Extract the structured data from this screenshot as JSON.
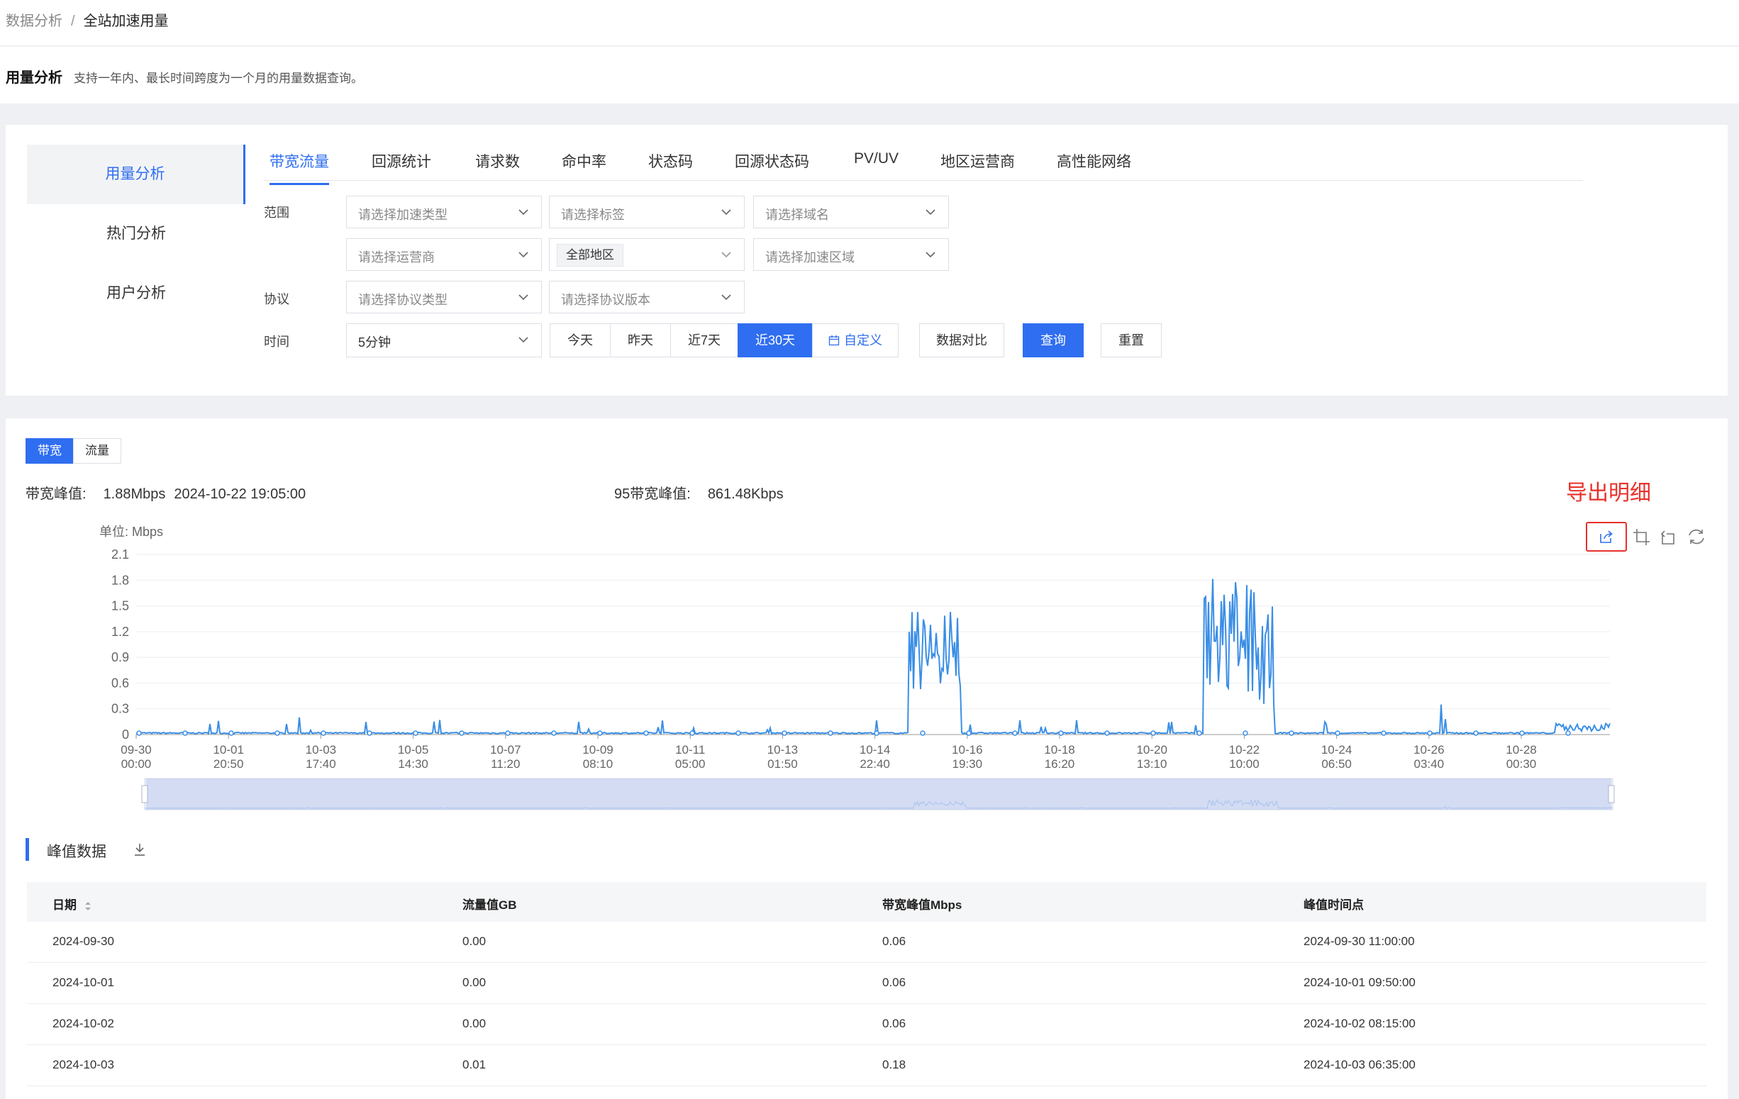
{
  "breadcrumb": {
    "parent": "数据分析",
    "separator": "/",
    "current": "全站加速用量"
  },
  "header": {
    "title": "用量分析",
    "description": "支持一年内、最长时间跨度为一个月的用量数据查询。"
  },
  "sidebar": {
    "items": [
      {
        "label": "用量分析",
        "active": true
      },
      {
        "label": "热门分析",
        "active": false
      },
      {
        "label": "用户分析",
        "active": false
      }
    ]
  },
  "tabs": [
    {
      "label": "带宽流量",
      "active": true
    },
    {
      "label": "回源统计"
    },
    {
      "label": "请求数"
    },
    {
      "label": "命中率"
    },
    {
      "label": "状态码"
    },
    {
      "label": "回源状态码"
    },
    {
      "label": "PV/UV"
    },
    {
      "label": "地区运营商"
    },
    {
      "label": "高性能网络"
    }
  ],
  "filters": {
    "range_label": "范围",
    "protocol_label": "协议",
    "time_label": "时间",
    "accel_type_placeholder": "请选择加速类型",
    "tag_placeholder": "请选择标签",
    "domain_placeholder": "请选择域名",
    "isp_placeholder": "请选择运营商",
    "region_value": "全部地区",
    "accel_region_placeholder": "请选择加速区域",
    "protocol_type_placeholder": "请选择协议类型",
    "protocol_version_placeholder": "请选择协议版本",
    "granularity_value": "5分钟",
    "quick_ranges": [
      {
        "label": "今天"
      },
      {
        "label": "昨天"
      },
      {
        "label": "近7天"
      },
      {
        "label": "近30天",
        "active": true
      },
      {
        "label": "自定义",
        "icon": "calendar-icon"
      }
    ],
    "compare_label": "数据对比",
    "query_label": "查询",
    "reset_label": "重置"
  },
  "metric_tabs": [
    {
      "label": "带宽",
      "active": true
    },
    {
      "label": "流量"
    }
  ],
  "stats": {
    "peak_label": "带宽峰值:",
    "peak_value": "1.88Mbps",
    "peak_time": "2024-10-22 19:05:00",
    "p95_label": "95带宽峰值:",
    "p95_value": "861.48Kbps"
  },
  "export_note": "导出明细",
  "toolbox_icons": [
    "export-icon",
    "zoom-select-icon",
    "zoom-reset-icon",
    "restore-icon"
  ],
  "chart_data": {
    "type": "line",
    "unit_label": "单位: Mbps",
    "ylim": [
      0,
      2.1
    ],
    "yticks": [
      "2.1",
      "1.8",
      "1.5",
      "1.2",
      "0.9",
      "0.6",
      "0.3",
      "0"
    ],
    "xticks": [
      [
        "09-30",
        "00:00"
      ],
      [
        "10-01",
        "20:50"
      ],
      [
        "10-03",
        "17:40"
      ],
      [
        "10-05",
        "14:30"
      ],
      [
        "10-07",
        "11:20"
      ],
      [
        "10-09",
        "08:10"
      ],
      [
        "10-11",
        "05:00"
      ],
      [
        "10-13",
        "01:50"
      ],
      [
        "10-14",
        "22:40"
      ],
      [
        "10-16",
        "19:30"
      ],
      [
        "10-18",
        "16:20"
      ],
      [
        "10-20",
        "13:10"
      ],
      [
        "10-22",
        "10:00"
      ],
      [
        "10-24",
        "06:50"
      ],
      [
        "10-26",
        "03:40"
      ],
      [
        "10-28",
        "00:30"
      ]
    ],
    "grid": true,
    "series": [
      {
        "color": "#3a8ee6",
        "description_points": [
          {
            "x": "2024-10-15",
            "y_range": [
              0.5,
              1.45
            ]
          },
          {
            "x": "2024-10-22",
            "y_range": [
              0.3,
              1.88
            ]
          },
          {
            "x": "2024-10-26",
            "y": 0.35
          },
          {
            "x": "2024-10-29",
            "y_range": [
              0.03,
              0.15
            ]
          }
        ]
      }
    ]
  },
  "peak_section": {
    "title": "峰值数据"
  },
  "table": {
    "columns": [
      "日期",
      "流量值GB",
      "带宽峰值Mbps",
      "峰值时间点"
    ],
    "rows": [
      [
        "2024-09-30",
        "0.00",
        "0.06",
        "2024-09-30 11:00:00"
      ],
      [
        "2024-10-01",
        "0.00",
        "0.06",
        "2024-10-01 09:50:00"
      ],
      [
        "2024-10-02",
        "0.00",
        "0.06",
        "2024-10-02 08:15:00"
      ],
      [
        "2024-10-03",
        "0.01",
        "0.18",
        "2024-10-03 06:35:00"
      ]
    ]
  }
}
